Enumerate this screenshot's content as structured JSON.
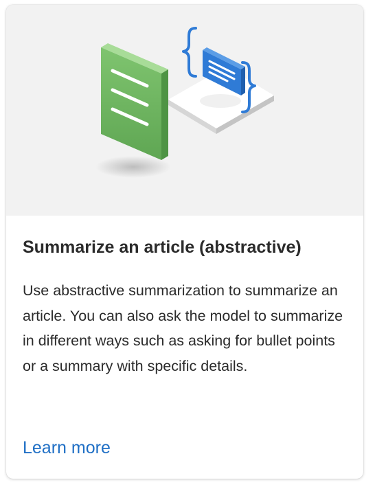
{
  "card": {
    "title": "Summarize an article (abstractive)",
    "description": "Use abstractive summarization to summarize an article. You can also ask the model to summarize in different ways such as asking for bullet points or a summary with specific details.",
    "link_label": "Learn more"
  },
  "illustration": {
    "icons": [
      "document-icon",
      "braces-icon",
      "message-icon",
      "platform-icon"
    ]
  },
  "colors": {
    "hero_background": "#f2f2f2",
    "document_green": "#6cb55f",
    "accent_blue": "#2f7bd6",
    "link_blue": "#1f6fc5",
    "text": "#2b2b2b"
  }
}
